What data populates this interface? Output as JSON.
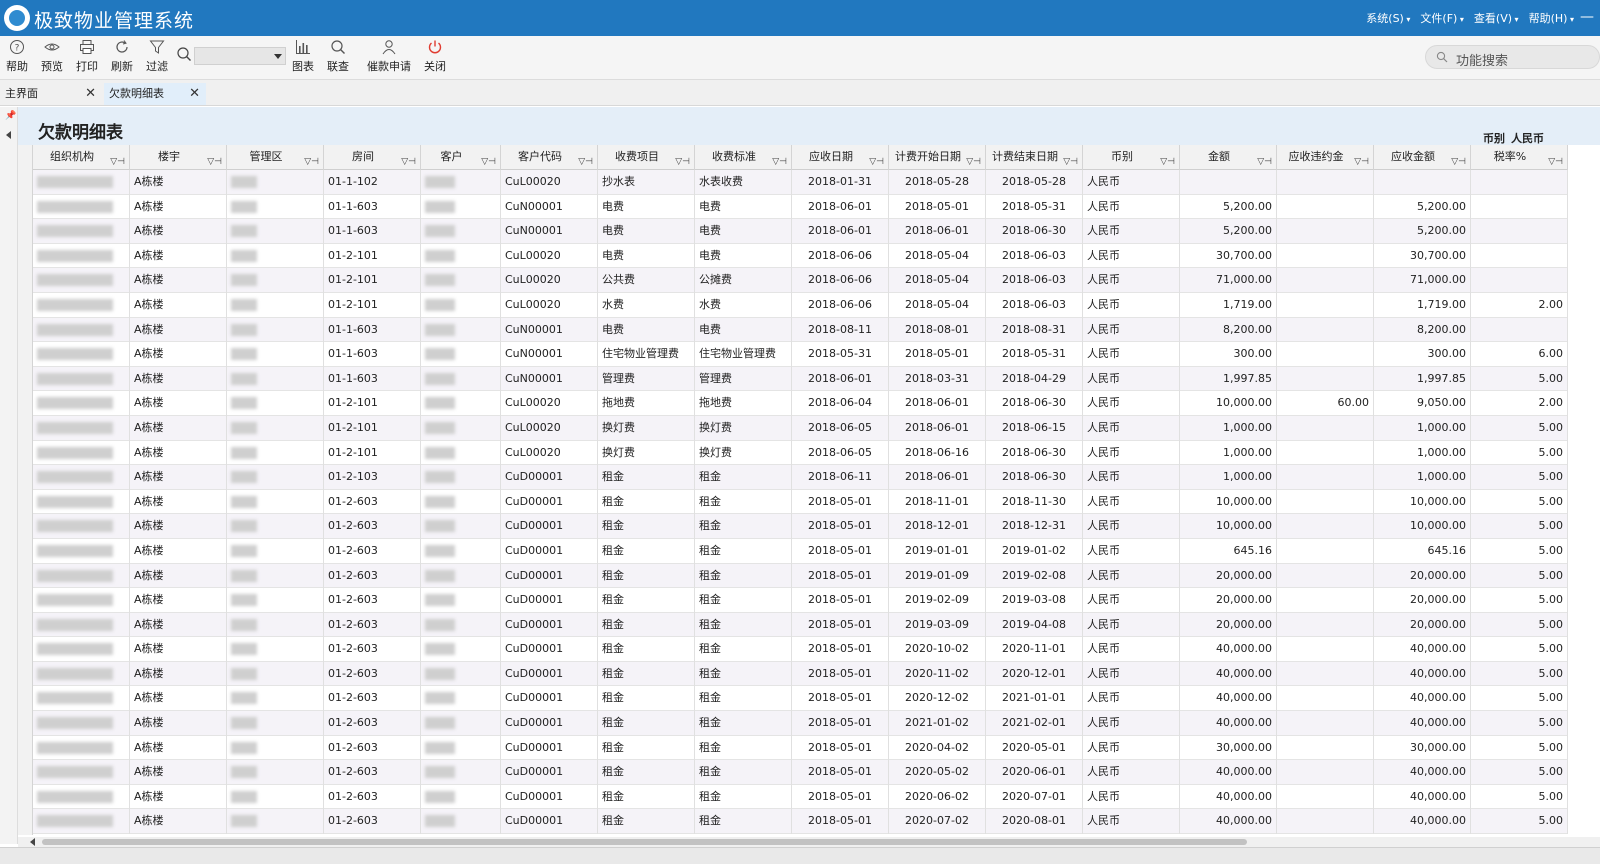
{
  "app": {
    "title": "极致物业管理系统",
    "menus": [
      "系统(S)",
      "文件(F)",
      "查看(V)",
      "帮助(H)"
    ],
    "window_control": "—"
  },
  "toolbar": {
    "buttons": [
      {
        "label": "帮助",
        "icon": "help-icon"
      },
      {
        "label": "预览",
        "icon": "eye-icon"
      },
      {
        "label": "打印",
        "icon": "printer-icon"
      },
      {
        "label": "刷新",
        "icon": "refresh-icon"
      },
      {
        "label": "过滤",
        "icon": "filter-icon"
      },
      {
        "label": "图表",
        "icon": "bar-chart-icon"
      },
      {
        "label": "联查",
        "icon": "search-icon"
      },
      {
        "label": "催款申请",
        "icon": "user-icon"
      },
      {
        "label": "关闭",
        "icon": "power-icon"
      }
    ],
    "combo_value": "",
    "function_search_placeholder": "功能搜索"
  },
  "tabs": [
    {
      "label": "主界面",
      "active": false
    },
    {
      "label": "欠款明细表",
      "active": true
    }
  ],
  "report": {
    "title": "欠款明细表",
    "currency_label": "币别",
    "currency_value": "人民币"
  },
  "colors": {
    "title_bar": "#2178bf",
    "header_band": "#e4eef8",
    "close_icon": "#e03c31"
  },
  "table": {
    "columns": [
      "组织机构",
      "楼宇",
      "管理区",
      "房间",
      "客户",
      "客户代码",
      "收费项目",
      "收费标准",
      "应收日期",
      "计费开始日期",
      "计费结束日期",
      "币别",
      "金额",
      "应收违约金",
      "应收金额",
      "税率%"
    ],
    "rows": [
      [
        "",
        "A栋楼",
        "",
        "01-1-102",
        "",
        "CuL00020",
        "抄水表",
        "水表收费",
        "2018-01-31",
        "2018-05-28",
        "2018-05-28",
        "人民币",
        "",
        "",
        "",
        ""
      ],
      [
        "",
        "A栋楼",
        "",
        "01-1-603",
        "",
        "CuN00001",
        "电费",
        "电费",
        "2018-06-01",
        "2018-05-01",
        "2018-05-31",
        "人民币",
        "5,200.00",
        "",
        "5,200.00",
        ""
      ],
      [
        "",
        "A栋楼",
        "",
        "01-1-603",
        "",
        "CuN00001",
        "电费",
        "电费",
        "2018-06-01",
        "2018-06-01",
        "2018-06-30",
        "人民币",
        "5,200.00",
        "",
        "5,200.00",
        ""
      ],
      [
        "",
        "A栋楼",
        "",
        "01-2-101",
        "",
        "CuL00020",
        "电费",
        "电费",
        "2018-06-06",
        "2018-05-04",
        "2018-06-03",
        "人民币",
        "30,700.00",
        "",
        "30,700.00",
        ""
      ],
      [
        "",
        "A栋楼",
        "",
        "01-2-101",
        "",
        "CuL00020",
        "公共费",
        "公摊费",
        "2018-06-06",
        "2018-05-04",
        "2018-06-03",
        "人民币",
        "71,000.00",
        "",
        "71,000.00",
        ""
      ],
      [
        "",
        "A栋楼",
        "",
        "01-2-101",
        "",
        "CuL00020",
        "水费",
        "水费",
        "2018-06-06",
        "2018-05-04",
        "2018-06-03",
        "人民币",
        "1,719.00",
        "",
        "1,719.00",
        "2.00"
      ],
      [
        "",
        "A栋楼",
        "",
        "01-1-603",
        "",
        "CuN00001",
        "电费",
        "电费",
        "2018-08-11",
        "2018-08-01",
        "2018-08-31",
        "人民币",
        "8,200.00",
        "",
        "8,200.00",
        ""
      ],
      [
        "",
        "A栋楼",
        "",
        "01-1-603",
        "",
        "CuN00001",
        "住宅物业管理费",
        "住宅物业管理费",
        "2018-05-31",
        "2018-05-01",
        "2018-05-31",
        "人民币",
        "300.00",
        "",
        "300.00",
        "6.00"
      ],
      [
        "",
        "A栋楼",
        "",
        "01-1-603",
        "",
        "CuN00001",
        "管理费",
        "管理费",
        "2018-06-01",
        "2018-03-31",
        "2018-04-29",
        "人民币",
        "1,997.85",
        "",
        "1,997.85",
        "5.00"
      ],
      [
        "",
        "A栋楼",
        "",
        "01-2-101",
        "",
        "CuL00020",
        "拖地费",
        "拖地费",
        "2018-06-04",
        "2018-06-01",
        "2018-06-30",
        "人民币",
        "10,000.00",
        "60.00",
        "9,050.00",
        "2.00"
      ],
      [
        "",
        "A栋楼",
        "",
        "01-2-101",
        "",
        "CuL00020",
        "换灯费",
        "换灯费",
        "2018-06-05",
        "2018-06-01",
        "2018-06-15",
        "人民币",
        "1,000.00",
        "",
        "1,000.00",
        "5.00"
      ],
      [
        "",
        "A栋楼",
        "",
        "01-2-101",
        "",
        "CuL00020",
        "换灯费",
        "换灯费",
        "2018-06-05",
        "2018-06-16",
        "2018-06-30",
        "人民币",
        "1,000.00",
        "",
        "1,000.00",
        "5.00"
      ],
      [
        "",
        "A栋楼",
        "",
        "01-2-103",
        "",
        "CuD00001",
        "租金",
        "租金",
        "2018-06-11",
        "2018-06-01",
        "2018-06-30",
        "人民币",
        "1,000.00",
        "",
        "1,000.00",
        "5.00"
      ],
      [
        "",
        "A栋楼",
        "",
        "01-2-603",
        "",
        "CuD00001",
        "租金",
        "租金",
        "2018-05-01",
        "2018-11-01",
        "2018-11-30",
        "人民币",
        "10,000.00",
        "",
        "10,000.00",
        "5.00"
      ],
      [
        "",
        "A栋楼",
        "",
        "01-2-603",
        "",
        "CuD00001",
        "租金",
        "租金",
        "2018-05-01",
        "2018-12-01",
        "2018-12-31",
        "人民币",
        "10,000.00",
        "",
        "10,000.00",
        "5.00"
      ],
      [
        "",
        "A栋楼",
        "",
        "01-2-603",
        "",
        "CuD00001",
        "租金",
        "租金",
        "2018-05-01",
        "2019-01-01",
        "2019-01-02",
        "人民币",
        "645.16",
        "",
        "645.16",
        "5.00"
      ],
      [
        "",
        "A栋楼",
        "",
        "01-2-603",
        "",
        "CuD00001",
        "租金",
        "租金",
        "2018-05-01",
        "2019-01-09",
        "2019-02-08",
        "人民币",
        "20,000.00",
        "",
        "20,000.00",
        "5.00"
      ],
      [
        "",
        "A栋楼",
        "",
        "01-2-603",
        "",
        "CuD00001",
        "租金",
        "租金",
        "2018-05-01",
        "2019-02-09",
        "2019-03-08",
        "人民币",
        "20,000.00",
        "",
        "20,000.00",
        "5.00"
      ],
      [
        "",
        "A栋楼",
        "",
        "01-2-603",
        "",
        "CuD00001",
        "租金",
        "租金",
        "2018-05-01",
        "2019-03-09",
        "2019-04-08",
        "人民币",
        "20,000.00",
        "",
        "20,000.00",
        "5.00"
      ],
      [
        "",
        "A栋楼",
        "",
        "01-2-603",
        "",
        "CuD00001",
        "租金",
        "租金",
        "2018-05-01",
        "2020-10-02",
        "2020-11-01",
        "人民币",
        "40,000.00",
        "",
        "40,000.00",
        "5.00"
      ],
      [
        "",
        "A栋楼",
        "",
        "01-2-603",
        "",
        "CuD00001",
        "租金",
        "租金",
        "2018-05-01",
        "2020-11-02",
        "2020-12-01",
        "人民币",
        "40,000.00",
        "",
        "40,000.00",
        "5.00"
      ],
      [
        "",
        "A栋楼",
        "",
        "01-2-603",
        "",
        "CuD00001",
        "租金",
        "租金",
        "2018-05-01",
        "2020-12-02",
        "2021-01-01",
        "人民币",
        "40,000.00",
        "",
        "40,000.00",
        "5.00"
      ],
      [
        "",
        "A栋楼",
        "",
        "01-2-603",
        "",
        "CuD00001",
        "租金",
        "租金",
        "2018-05-01",
        "2021-01-02",
        "2021-02-01",
        "人民币",
        "40,000.00",
        "",
        "40,000.00",
        "5.00"
      ],
      [
        "",
        "A栋楼",
        "",
        "01-2-603",
        "",
        "CuD00001",
        "租金",
        "租金",
        "2018-05-01",
        "2020-04-02",
        "2020-05-01",
        "人民币",
        "30,000.00",
        "",
        "30,000.00",
        "5.00"
      ],
      [
        "",
        "A栋楼",
        "",
        "01-2-603",
        "",
        "CuD00001",
        "租金",
        "租金",
        "2018-05-01",
        "2020-05-02",
        "2020-06-01",
        "人民币",
        "40,000.00",
        "",
        "40,000.00",
        "5.00"
      ],
      [
        "",
        "A栋楼",
        "",
        "01-2-603",
        "",
        "CuD00001",
        "租金",
        "租金",
        "2018-05-01",
        "2020-06-02",
        "2020-07-01",
        "人民币",
        "40,000.00",
        "",
        "40,000.00",
        "5.00"
      ],
      [
        "",
        "A栋楼",
        "",
        "01-2-603",
        "",
        "CuD00001",
        "租金",
        "租金",
        "2018-05-01",
        "2020-07-02",
        "2020-08-01",
        "人民币",
        "40,000.00",
        "",
        "40,000.00",
        "5.00"
      ]
    ]
  }
}
